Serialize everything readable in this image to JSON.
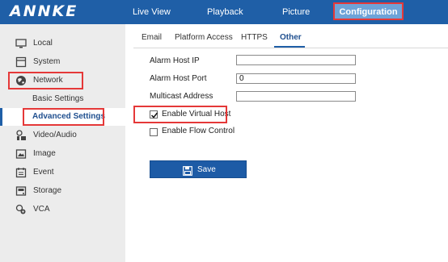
{
  "brand": {
    "logo": "ANNKE"
  },
  "top_nav": {
    "items": [
      "Live View",
      "Playback",
      "Picture"
    ],
    "active": "Configuration"
  },
  "sidebar": {
    "items": [
      {
        "label": "Local",
        "icon": "monitor-icon"
      },
      {
        "label": "System",
        "icon": "system-icon"
      },
      {
        "label": "Network",
        "icon": "globe-icon"
      },
      {
        "label": "Basic Settings",
        "icon": ""
      },
      {
        "label": "Advanced Settings",
        "icon": ""
      },
      {
        "label": "Video/Audio",
        "icon": "video-audio-icon"
      },
      {
        "label": "Image",
        "icon": "image-icon"
      },
      {
        "label": "Event",
        "icon": "calendar-icon"
      },
      {
        "label": "Storage",
        "icon": "storage-icon"
      },
      {
        "label": "VCA",
        "icon": "vca-icon"
      }
    ],
    "selected": "Advanced Settings"
  },
  "tabs": {
    "items": [
      "Email",
      "Platform Access",
      "HTTPS",
      "Other"
    ],
    "active": "Other"
  },
  "form": {
    "alarm_host_ip_label": "Alarm Host IP",
    "alarm_host_ip_value": "",
    "alarm_host_port_label": "Alarm Host Port",
    "alarm_host_port_value": "0",
    "multicast_address_label": "Multicast Address",
    "multicast_address_value": "",
    "enable_virtual_host_label": "Enable Virtual Host",
    "enable_virtual_host_checked": true,
    "enable_flow_control_label": "Enable Flow Control",
    "enable_flow_control_checked": false,
    "save_label": "Save"
  },
  "colors": {
    "header_bg": "#1f5fa7",
    "active_nav_bg": "#6ea3d8",
    "highlight_border": "#e53838",
    "save_button_bg": "#1d5ba6",
    "sidebar_bg": "#ececec"
  }
}
